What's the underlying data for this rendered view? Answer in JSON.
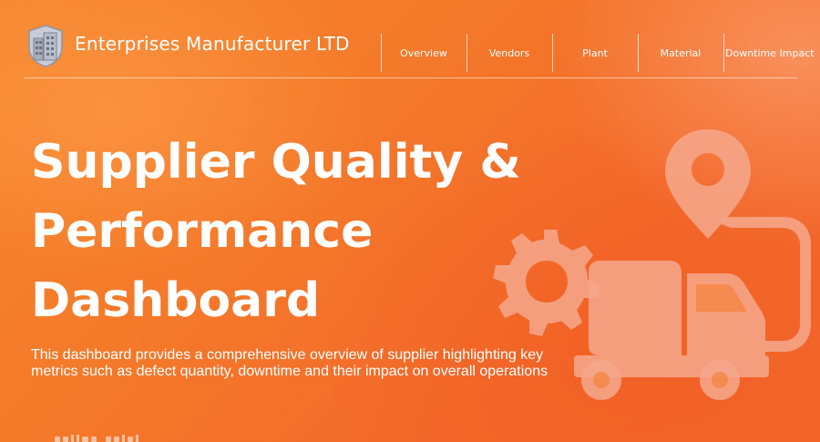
{
  "header": {
    "company_name": "Enterprises Manufacturer LTD",
    "nav": [
      {
        "label": "Overview"
      },
      {
        "label": "Vendors"
      },
      {
        "label": "Plant"
      },
      {
        "label": "Material"
      },
      {
        "label": "Downtime Impact"
      }
    ]
  },
  "hero": {
    "title_lines": [
      "Supplier Quality &",
      "Performance",
      "Dashboard"
    ],
    "description": "This dashboard provides a comprehensive overview of supplier highlighting key metrics such as defect quantity, downtime and their impact on overall operations"
  },
  "icons": {
    "logo": "building-shield-logo",
    "illustration": "delivery-truck-gear-location-icon"
  },
  "colors": {
    "background": "#f47a2a",
    "text": "#ffffff",
    "illustration": "#f5a889"
  }
}
